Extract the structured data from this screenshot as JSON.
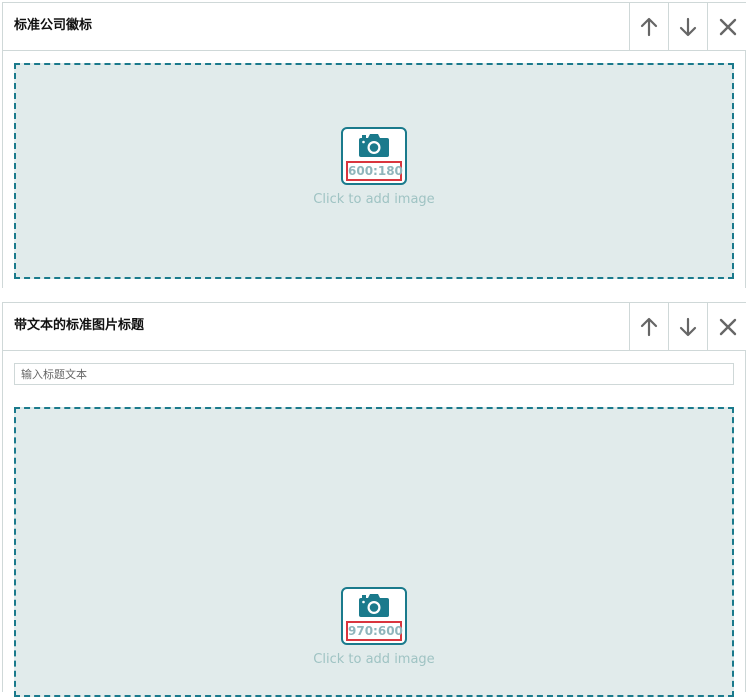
{
  "modules": [
    {
      "title": "标准公司徽标",
      "image": {
        "ratio": "600:180",
        "hint": "Click to add image"
      }
    },
    {
      "title": "带文本的标准图片标题",
      "headline_input": {
        "placeholder": "输入标题文本",
        "value": ""
      },
      "image": {
        "ratio": "970:600",
        "hint": "Click to add image"
      }
    }
  ],
  "icons": {
    "move_up": "arrow-up-icon",
    "move_down": "arrow-down-icon",
    "remove": "close-icon",
    "camera": "camera-icon"
  },
  "colors": {
    "accent": "#1a7a8c",
    "dropzone_bg": "#e1ebeb",
    "ratio_highlight": "#d9363e",
    "hint_text": "#9fc3c3"
  }
}
